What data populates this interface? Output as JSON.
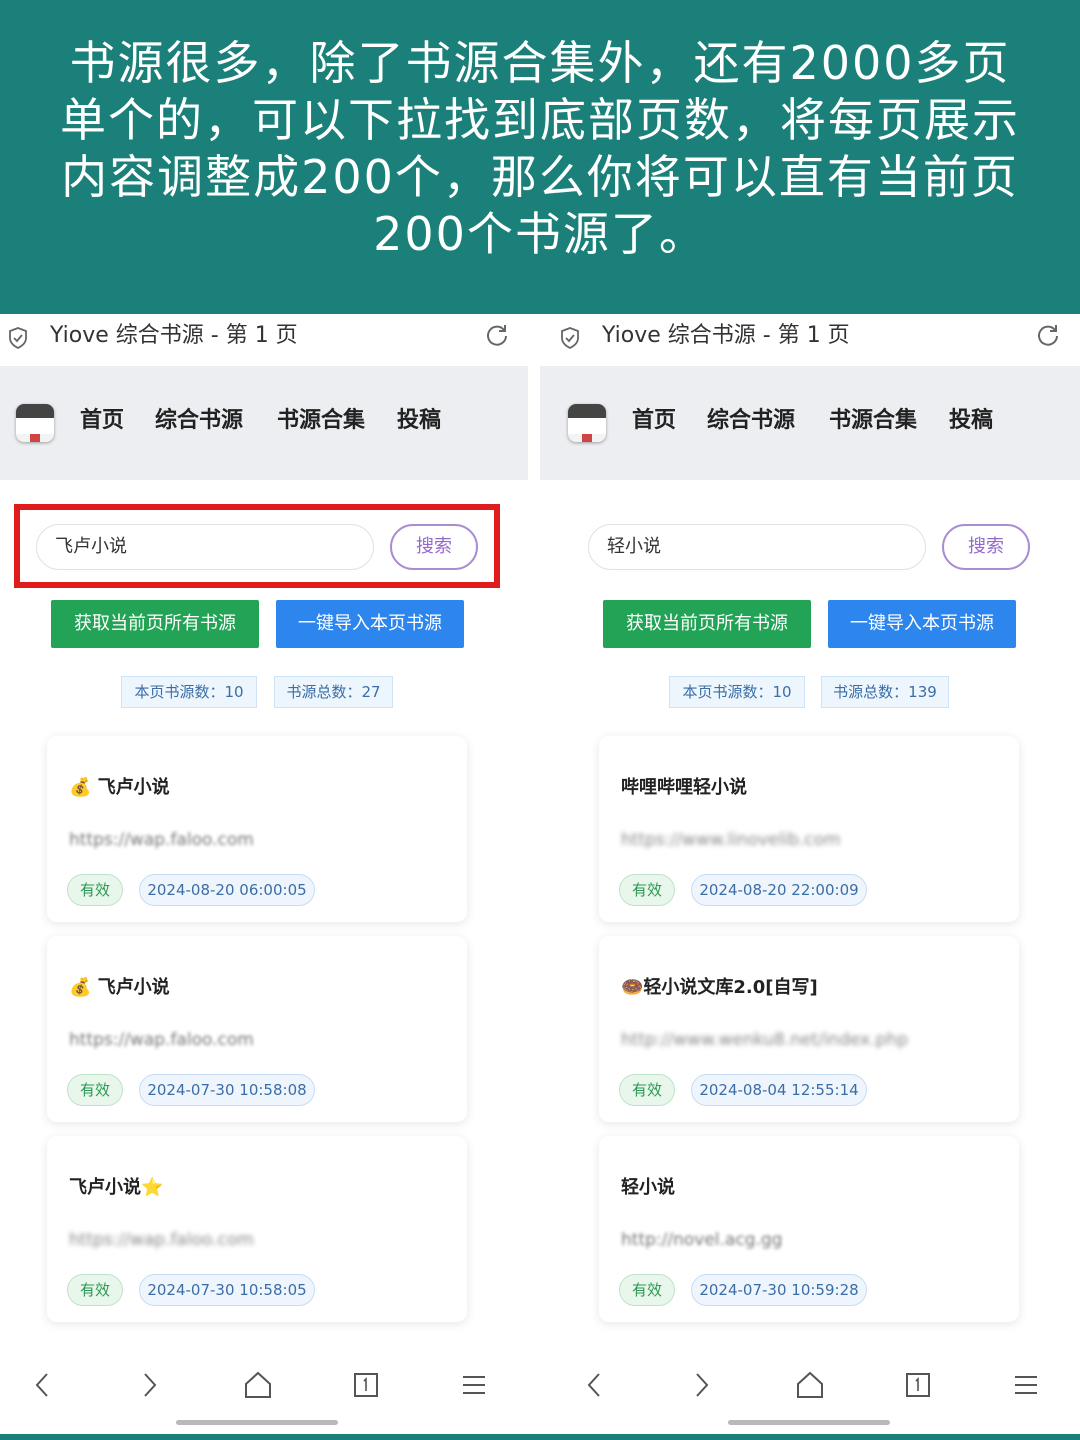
{
  "banner": {
    "lines": [
      "书源很多，除了书源合集外，还有2000多页",
      "单个的，可以下拉找到底部页数，将每页展示",
      "内容调整成200个，那么你将可以直有当前页",
      "200个书源了。"
    ]
  },
  "screens": [
    {
      "url_title": "Yiove 综合书源 - 第 1 页",
      "nav": [
        "首页",
        "综合书源",
        "书源合集",
        "投稿"
      ],
      "search_value": "飞卢小说",
      "search_button": "搜索",
      "btn_get_all": "获取当前页所有书源",
      "btn_import": "一键导入本页书源",
      "stat_page": "本页书源数：10",
      "stat_total": "书源总数：27",
      "cards": [
        {
          "title": "💰 飞卢小说",
          "url": "https://wap.faloo.com",
          "status": "有效",
          "date": "2024-08-20 06:00:05"
        },
        {
          "title": "💰 飞卢小说",
          "url": "https://wap.faloo.com",
          "status": "有效",
          "date": "2024-07-30 10:58:08"
        },
        {
          "title": "飞卢小说⭐",
          "url": "https://wap.faloo.com",
          "status": "有效",
          "date": "2024-07-30 10:58:05"
        }
      ]
    },
    {
      "url_title": "Yiove 综合书源 - 第 1 页",
      "nav": [
        "首页",
        "综合书源",
        "书源合集",
        "投稿"
      ],
      "search_value": "轻小说",
      "search_button": "搜索",
      "btn_get_all": "获取当前页所有书源",
      "btn_import": "一键导入本页书源",
      "stat_page": "本页书源数：10",
      "stat_total": "书源总数：139",
      "cards": [
        {
          "title": "哔哩哔哩轻小说",
          "url": "https://www.linovelib.com",
          "status": "有效",
          "date": "2024-08-20 22:00:09"
        },
        {
          "title": "🍩轻小说文库2.0[自写]",
          "url": "http://www.wenku8.net/index.php",
          "status": "有效",
          "date": "2024-08-04 12:55:14"
        },
        {
          "title": "轻小说",
          "url": "http://novel.acg.gg",
          "status": "有效",
          "date": "2024-07-30 10:59:28"
        }
      ]
    }
  ],
  "icons": {
    "shield": "shield-check-icon",
    "reload": "reload-icon",
    "back": "chevron-left-icon",
    "forward": "chevron-right-icon",
    "home": "home-icon",
    "tabs": "tabs-icon",
    "menu": "menu-icon"
  },
  "colors": {
    "banner_bg": "#1b8079",
    "green_button": "#23a356",
    "blue_button": "#2d86ee",
    "highlight_box": "#e01b1b",
    "search_button_border": "#a98dd3"
  }
}
